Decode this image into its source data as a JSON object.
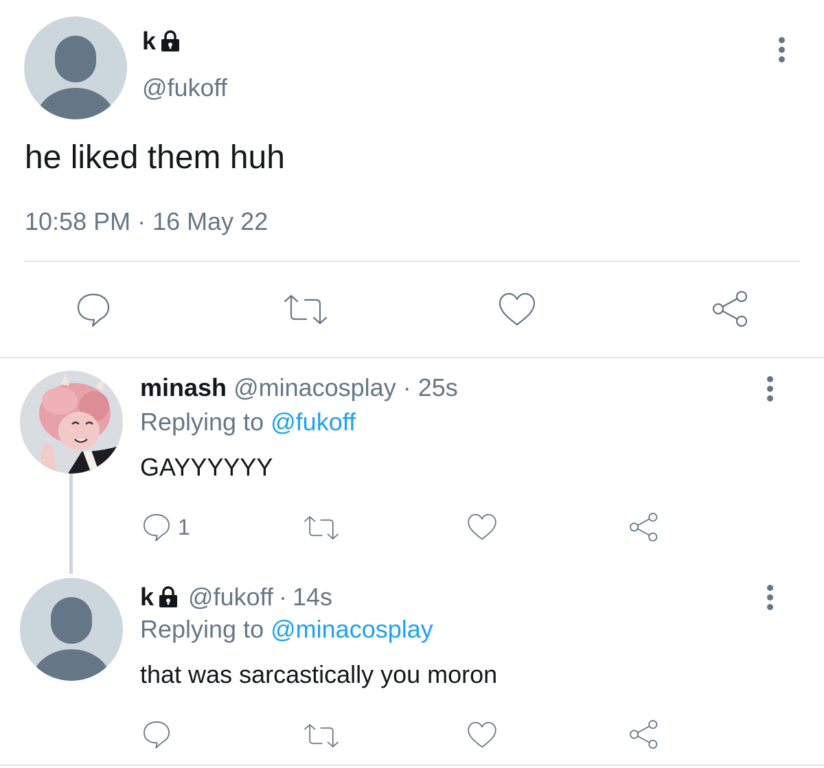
{
  "main_tweet": {
    "name": "k",
    "handle": "@fukoff",
    "text": "he liked them huh",
    "time": "10:58 PM",
    "separator": "·",
    "date": "16 May 22",
    "icons": [
      "more-vertical-icon",
      "lock-icon",
      "reply-icon",
      "retweet-icon",
      "like-icon",
      "share-icon"
    ]
  },
  "replies": [
    {
      "name": "minash",
      "handle": "@minacosplay",
      "separator": "·",
      "time": "25s",
      "replying_prefix": "Replying to",
      "replying_to": "@fukoff",
      "text": "GAYYYYYY",
      "reply_count": "1"
    },
    {
      "name": "k",
      "handle": "@fukoff",
      "separator": "·",
      "time": "14s",
      "replying_prefix": "Replying to",
      "replying_to": "@minacosplay",
      "text": "that was sarcastically you moron",
      "reply_count": ""
    }
  ],
  "colors": {
    "text": "#14171a",
    "secondary": "#657786",
    "link": "#1da1f2",
    "divider": "#e1e8ed",
    "avatar_bg": "#ccd6dd",
    "avatar_fg": "#657786",
    "thread_line": "#ccd6dd"
  }
}
